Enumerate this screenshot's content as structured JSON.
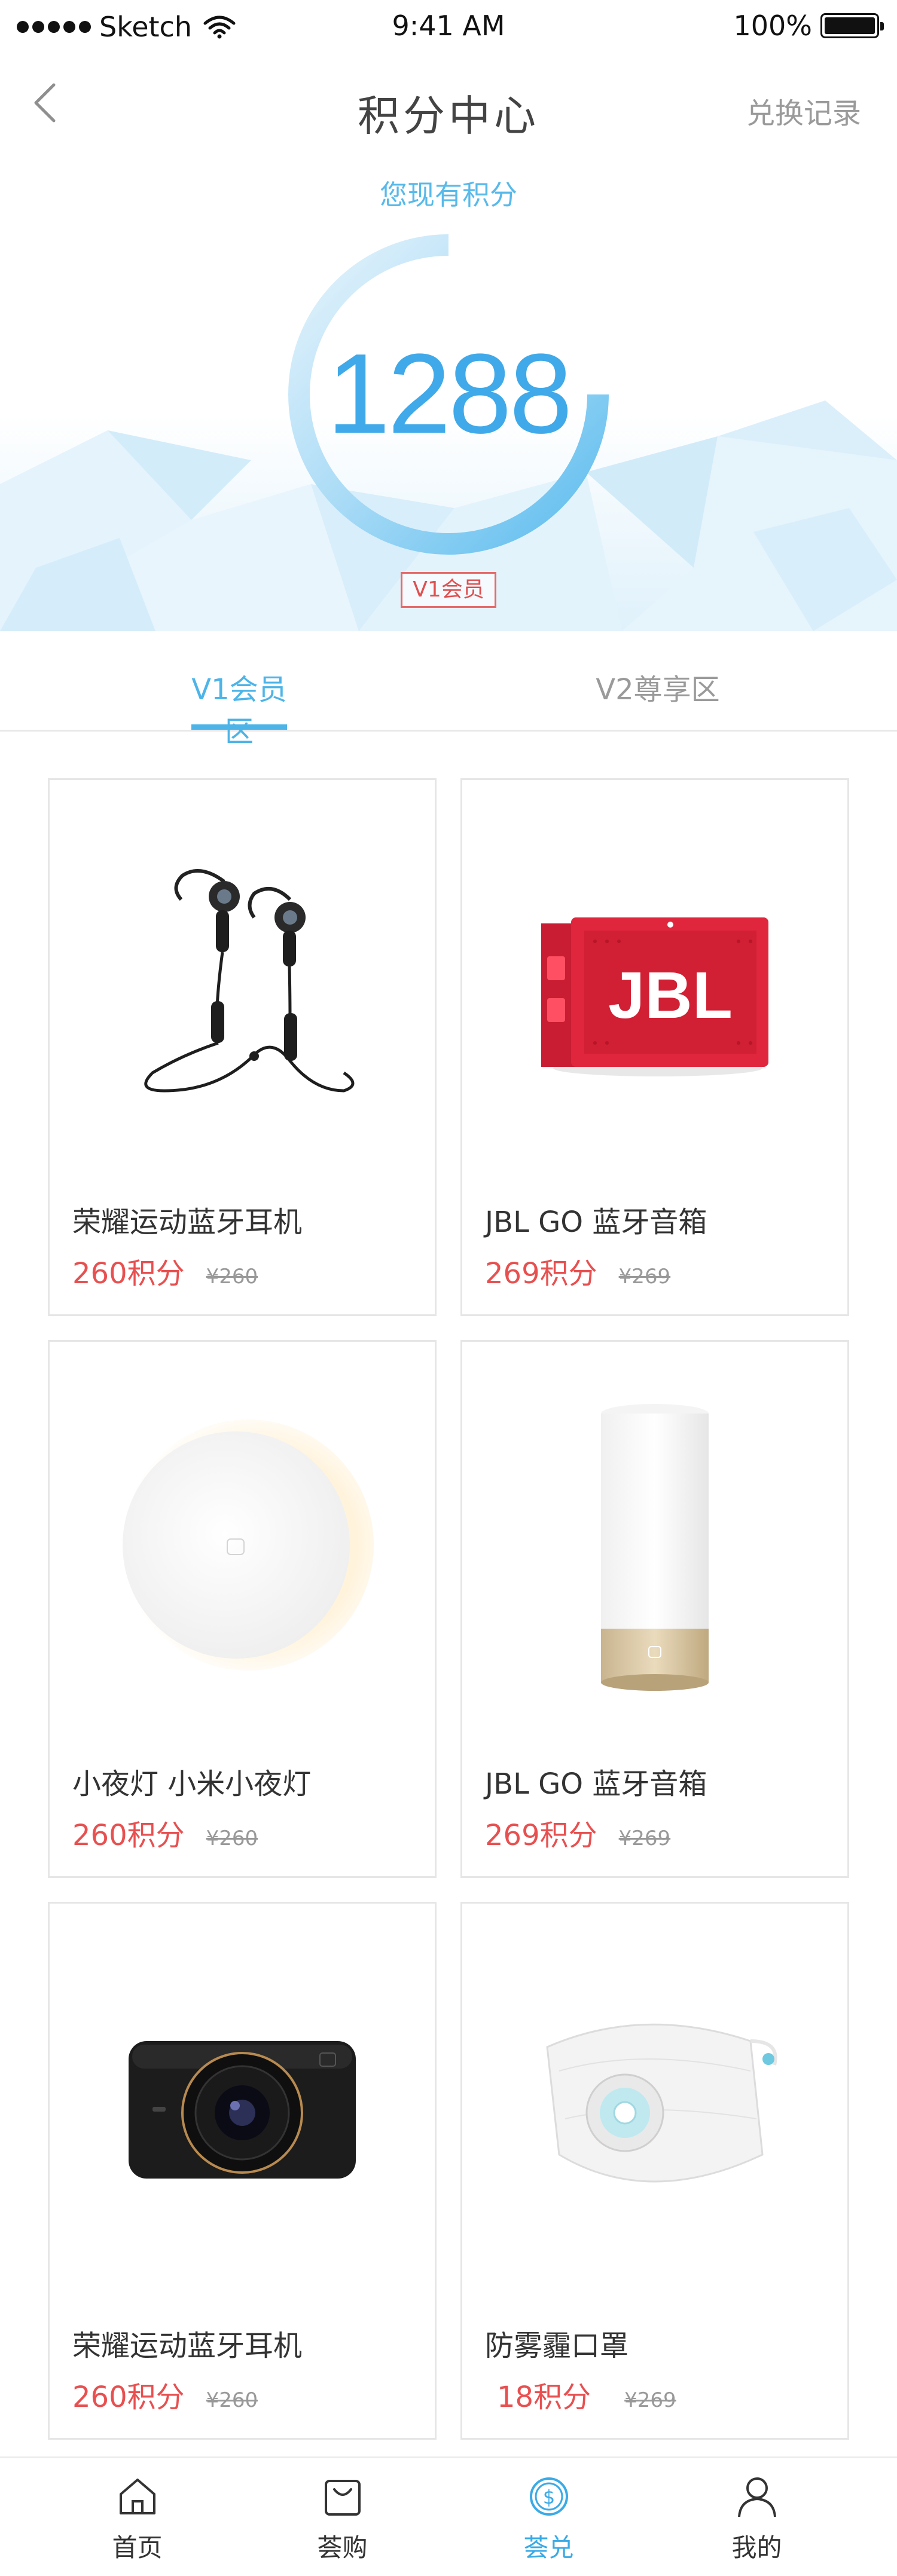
{
  "status_bar": {
    "carrier": "Sketch",
    "time": "9:41 AM",
    "battery": "100%"
  },
  "nav": {
    "title": "积分中心",
    "right_link": "兑换记录"
  },
  "points": {
    "caption": "您现有积分",
    "value": "1288",
    "level_badge": "V1会员"
  },
  "tabs": [
    {
      "label": "V1会员区",
      "active": true
    },
    {
      "label": "V2尊享区",
      "active": false
    }
  ],
  "products": [
    {
      "name": "荣耀运动蓝牙耳机",
      "points": "260积分",
      "original_price": "¥260",
      "image": "earphones"
    },
    {
      "name": "JBL GO 蓝牙音箱",
      "points": "269积分",
      "original_price": "¥269",
      "image": "speaker"
    },
    {
      "name": "小夜灯 小米小夜灯",
      "points": "260积分",
      "original_price": "¥260",
      "image": "night-light"
    },
    {
      "name": "JBL GO 蓝牙音箱",
      "points": "269积分",
      "original_price": "¥269",
      "image": "bedside-lamp"
    },
    {
      "name": "荣耀运动蓝牙耳机",
      "points": "260积分",
      "original_price": "¥260",
      "image": "dashcam"
    },
    {
      "name": "防雾霾口罩",
      "points": "18积分",
      "original_price": "¥269",
      "image": "mask"
    }
  ],
  "tabbar": [
    {
      "label": "首页",
      "icon": "home-icon",
      "active": false
    },
    {
      "label": "荟购",
      "icon": "shopping-bag-icon",
      "active": false
    },
    {
      "label": "荟兑",
      "icon": "coin-exchange-icon",
      "active": true
    },
    {
      "label": "我的",
      "icon": "user-icon",
      "active": false
    }
  ],
  "colors": {
    "accent": "#4db4e8",
    "price": "#e85050",
    "badge": "#e46a6a"
  }
}
